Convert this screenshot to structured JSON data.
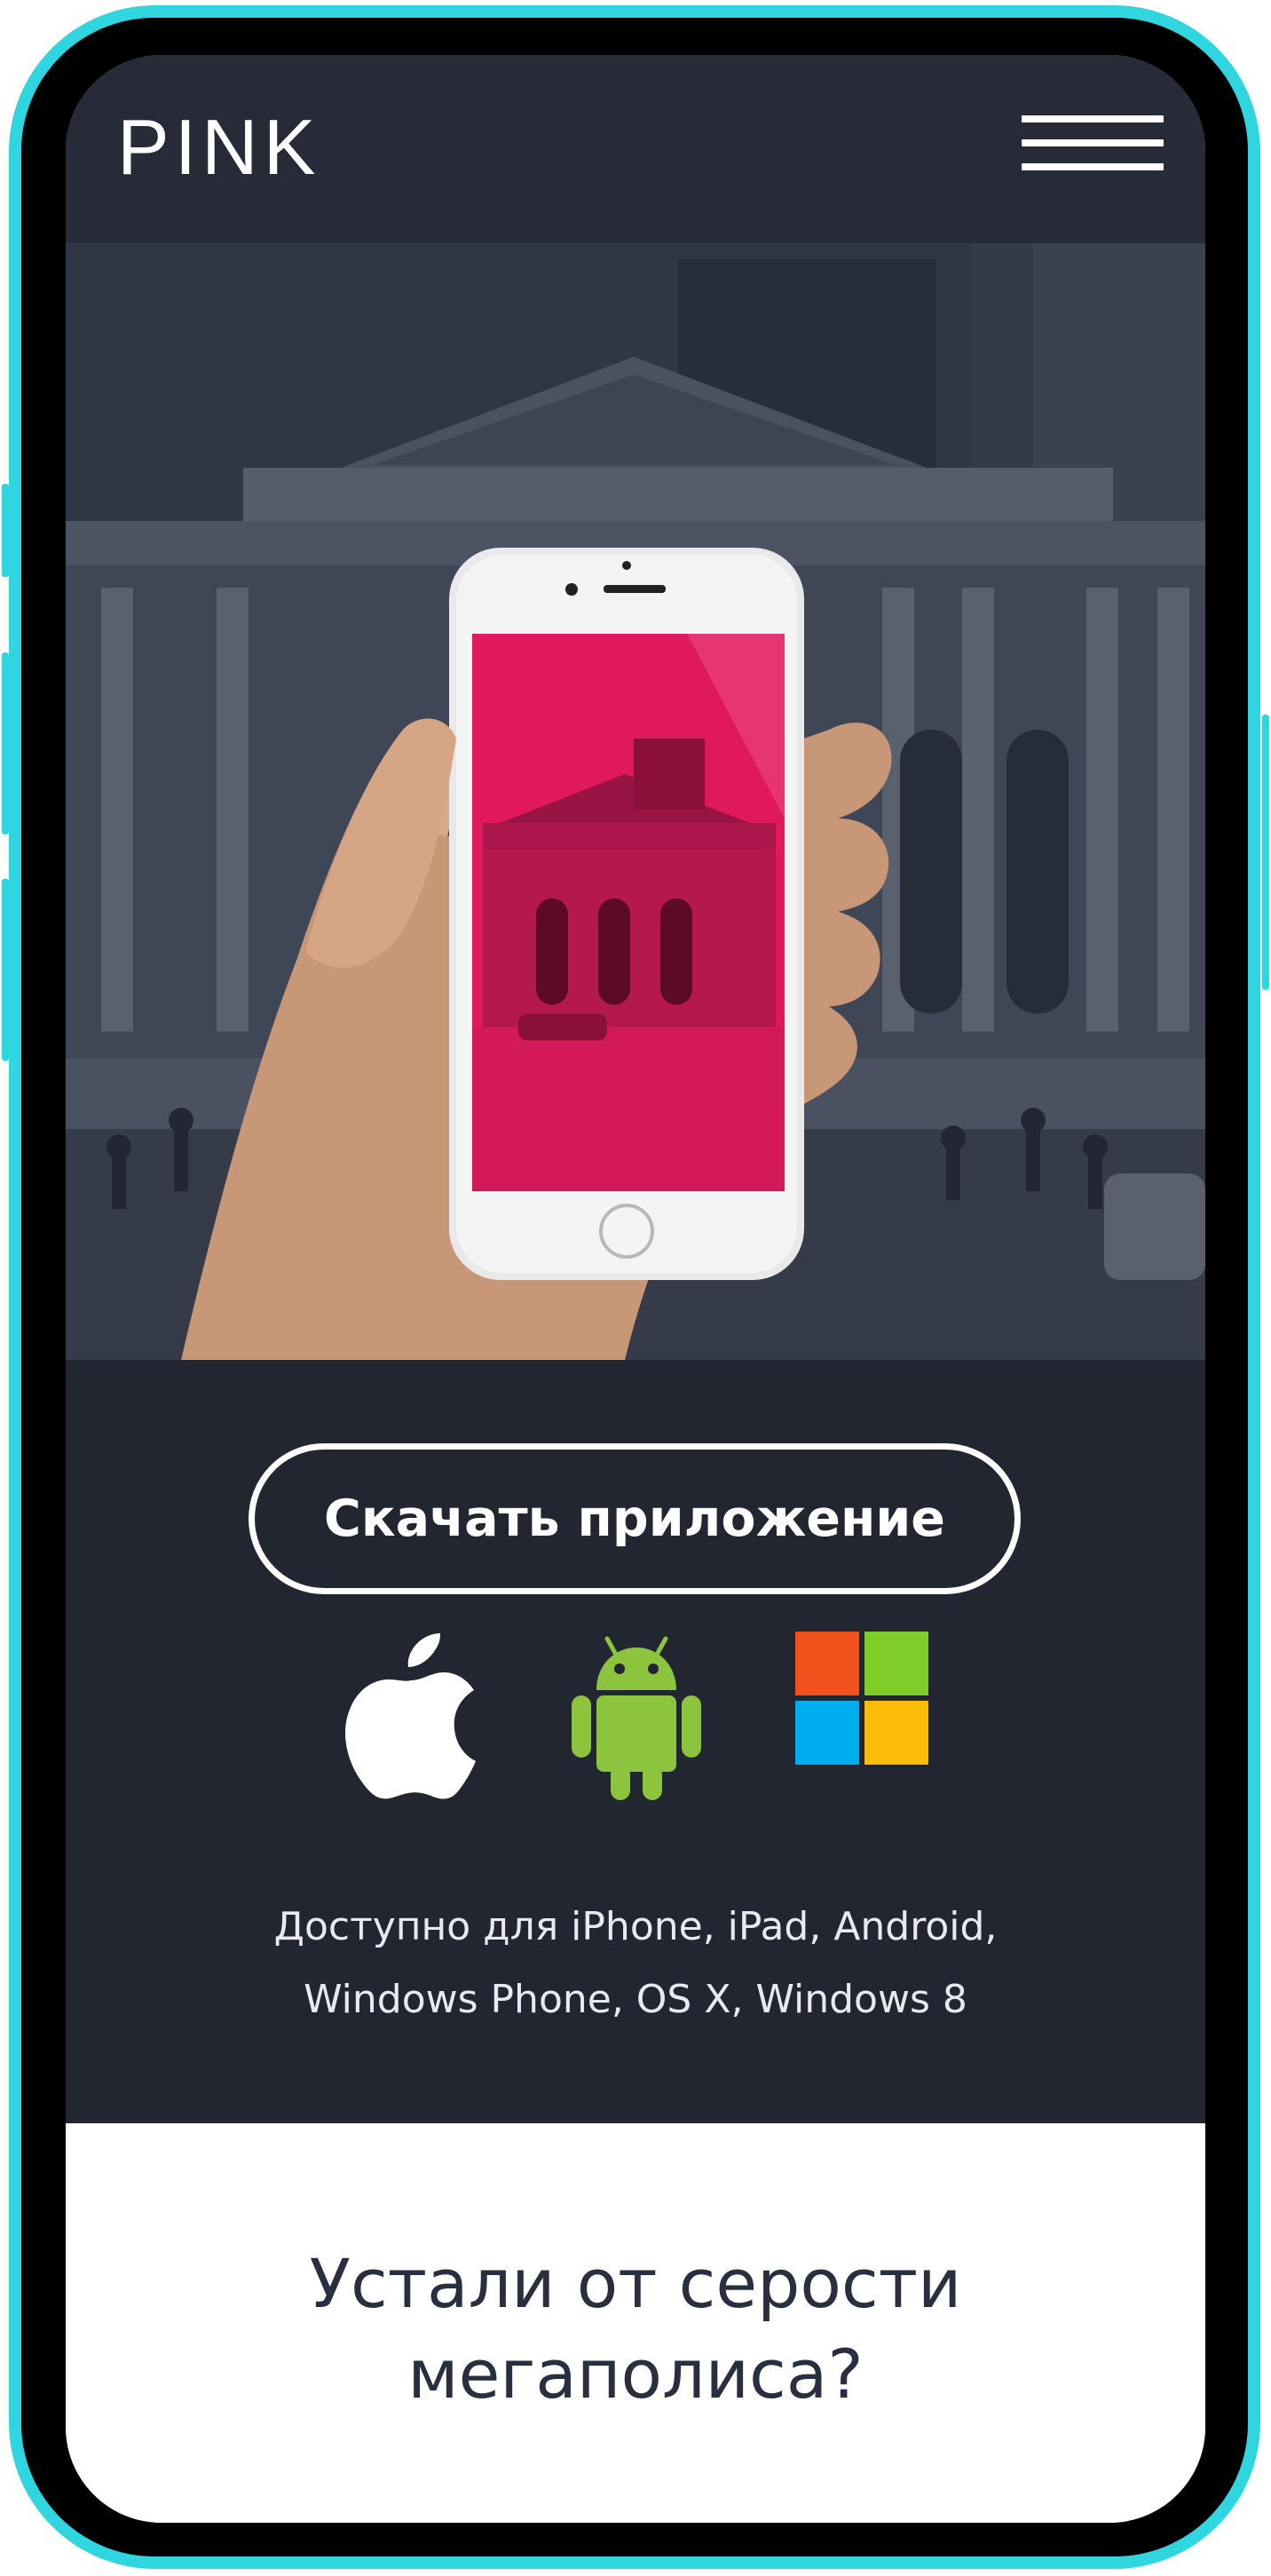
{
  "header": {
    "logo": "PINK",
    "menu_icon": "hamburger-menu-icon"
  },
  "hero": {
    "image": "hand-holding-phone-city-photo"
  },
  "download": {
    "button_label": "Скачать приложение",
    "platforms": [
      {
        "name": "apple-icon",
        "color": "#ffffff"
      },
      {
        "name": "android-icon",
        "color": "#8cc43d"
      },
      {
        "name": "windows-icon",
        "colors": [
          "#f1511b",
          "#80cc28",
          "#00adef",
          "#fbbc09"
        ]
      }
    ],
    "availability_line1": "Доступно для iPhone, iPad, Android,",
    "availability_line2": "Windows Phone, OS X, Windows 8"
  },
  "features": {
    "title_line1": "Устали от серости",
    "title_line2": "мегаполиса?"
  },
  "colors": {
    "device_frame": "#2fd6df",
    "accent_pink": "#e5185f",
    "dark_bg": "#222631",
    "header_bg": "#262b37"
  }
}
